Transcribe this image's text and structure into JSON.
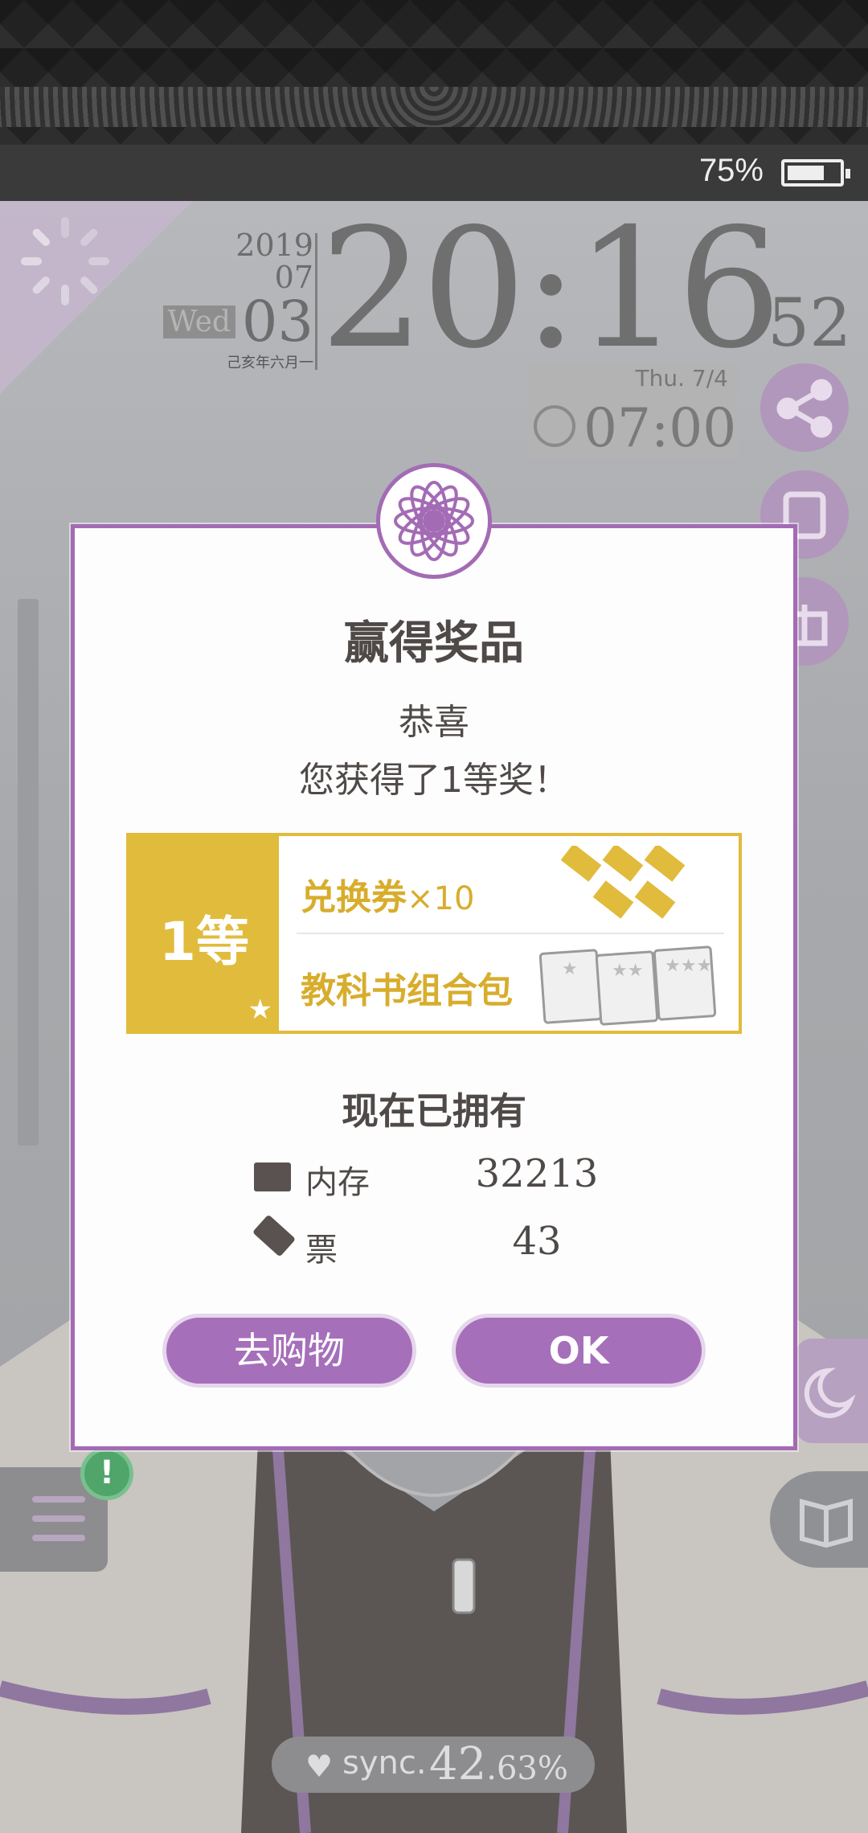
{
  "status_bar": {
    "battery_percent": "75%",
    "battery_level": 0.75
  },
  "clock": {
    "year": "2019",
    "month": "07",
    "weekday": "Wed",
    "day": "03",
    "lunar_date": "己亥年六月一",
    "time": "20:16",
    "seconds": "52"
  },
  "alarm": {
    "date": "Thu.  7/4",
    "time": "07:00"
  },
  "sync": {
    "label": "sync.",
    "value": "42",
    "decimal": ".63%"
  },
  "dialog": {
    "title": "赢得奖品",
    "congrats": "恭喜",
    "prize_message": "您获得了1等奖！",
    "prize": {
      "rank": "1等",
      "item_1": "兑换券",
      "item_1_qty": "×10",
      "item_2": "教科书组合包"
    },
    "owned_title": "现在已拥有",
    "memory_label": "内存",
    "memory_value": "32213",
    "ticket_label": "票",
    "ticket_value": "43",
    "shop_button": "去购物",
    "ok_button": "OK"
  },
  "colors": {
    "accent": "#a66fba",
    "gold": "#e1bb3c",
    "text": "#4f4a48"
  }
}
